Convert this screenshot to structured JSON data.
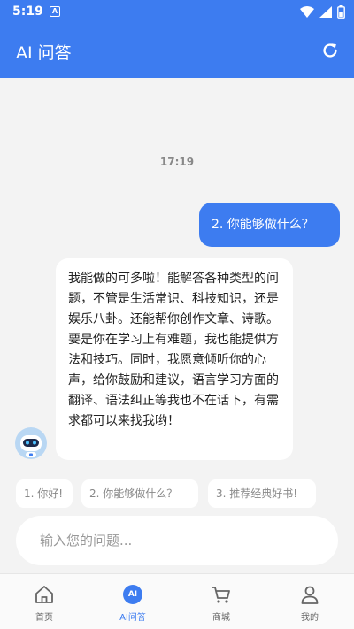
{
  "status_bar": {
    "time": "5:19",
    "notification_glyph": "A",
    "icons": [
      "wifi-icon",
      "signal-icon",
      "battery-icon"
    ]
  },
  "app_bar": {
    "title": "AI 问答",
    "refresh_icon": "refresh-icon"
  },
  "chat": {
    "timestamp": "17:19",
    "user_message": "2. 你能够做什么？",
    "bot_message": "我能做的可多啦！能解答各种类型的问题，不管是生活常识、科技知识，还是娱乐八卦。还能帮你创作文章、诗歌。要是你在学习上有难题，我也能提供方法和技巧。同时，我愿意倾听你的心声，给你鼓励和建议，语言学习方面的翻译、语法纠正等我也不在话下，有需求都可以来找我哟！"
  },
  "suggestions": [
    "1. 你好!",
    "2. 你能够做什么？",
    "3. 推荐经典好书!"
  ],
  "input": {
    "placeholder": "输入您的问题..."
  },
  "tabs": [
    {
      "label": "首页",
      "icon": "home-icon",
      "active": false
    },
    {
      "label": "AI问答",
      "icon": "ai-icon",
      "badge": "AI",
      "active": true
    },
    {
      "label": "商城",
      "icon": "cart-icon",
      "active": false
    },
    {
      "label": "我的",
      "icon": "profile-icon",
      "active": false
    }
  ],
  "colors": {
    "accent": "#3d7cf0",
    "background": "#f3f3f3",
    "bubble_bot": "#ffffff",
    "muted_text": "#888888"
  }
}
